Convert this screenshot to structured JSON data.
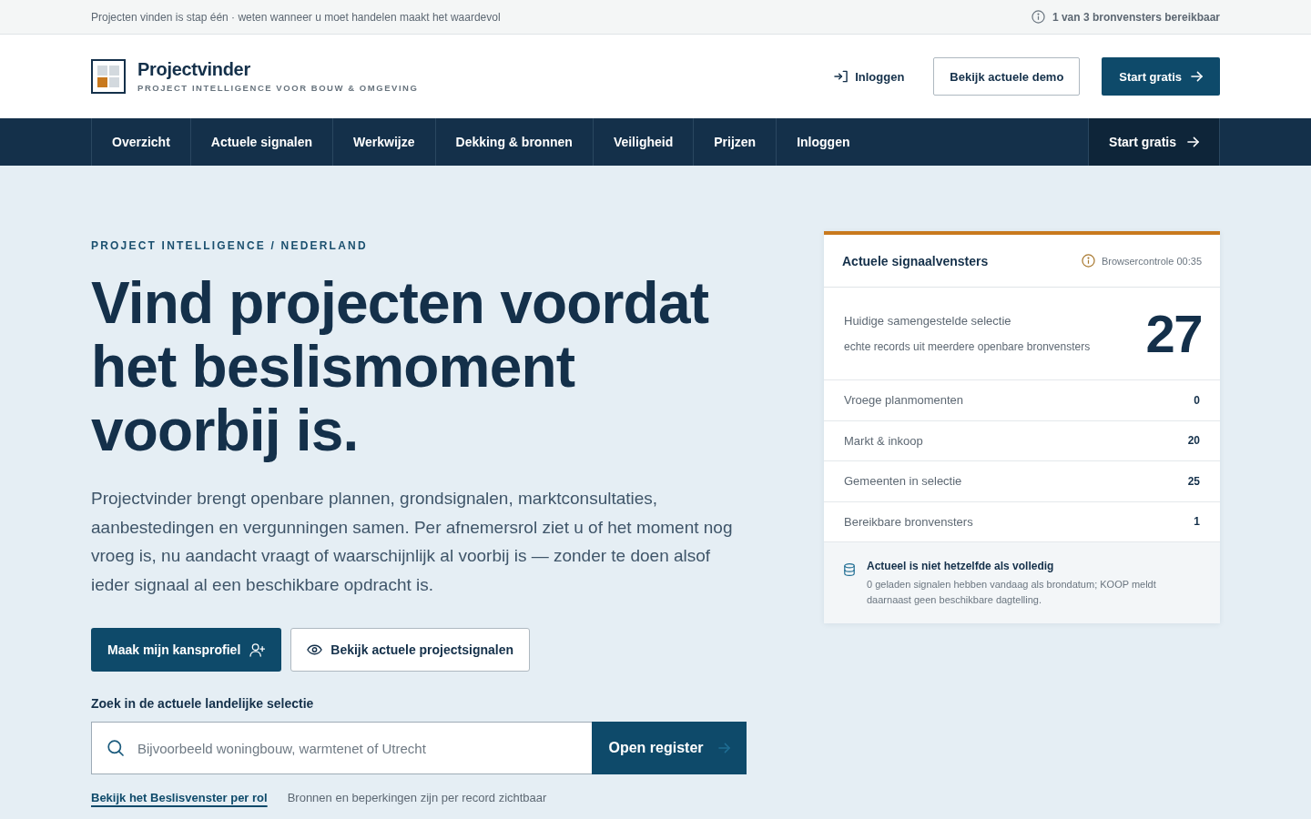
{
  "top_bar": {
    "tagline": "Projecten vinden is stap één · weten wanneer u moet handelen maakt het waardevol",
    "status": "1 van 3 bronvensters bereikbaar"
  },
  "header": {
    "brand": {
      "name": "Projectvinder",
      "subtitle": "PROJECT INTELLIGENCE VOOR BOUW & OMGEVING"
    },
    "actions": [
      {
        "label": "Inloggen",
        "kind": "link"
      },
      {
        "label": "Bekijk actuele demo",
        "kind": "outline"
      },
      {
        "label": "Start gratis",
        "kind": "primary"
      }
    ]
  },
  "nav": {
    "items": [
      {
        "label": "Overzicht"
      },
      {
        "label": "Actuele signalen"
      },
      {
        "label": "Werkwijze"
      },
      {
        "label": "Dekking & bronnen"
      },
      {
        "label": "Veiligheid"
      },
      {
        "label": "Prijzen"
      },
      {
        "label": "Inloggen"
      }
    ],
    "cta": "Start gratis"
  },
  "hero": {
    "eyebrow": "PROJECT INTELLIGENCE / NEDERLAND",
    "heading": "Vind projecten voordat het beslismoment voorbij is.",
    "intro": "Projectvinder brengt openbare plannen, grondsignalen, marktconsultaties, aanbestedingen en vergunningen samen. Per afnemersrol ziet u of het moment nog vroeg is, nu aandacht vraagt of waarschijnlijk al voorbij is — zonder te doen alsof ieder signaal al een beschikbare opdracht is.",
    "buttons": [
      {
        "label": "Maak mijn kansprofiel",
        "kind": "primary"
      },
      {
        "label": "Bekijk actuele projectsignalen",
        "kind": "secondary"
      }
    ],
    "search": {
      "label": "Zoek in de actuele landelijke selectie",
      "placeholder": "Bijvoorbeeld woningbouw, warmtenet of Utrecht",
      "button": "Open register"
    },
    "footer_link": "Bekijk het Beslisvenster per rol",
    "footer_note": "Bronnen en beperkingen zijn per record zichtbaar"
  },
  "signal_card": {
    "title": "Actuele signaalvensters",
    "check": "Browsercontrole 00:35",
    "summary": {
      "label": "Huidige samengestelde selectie",
      "sublabel": "echte records uit meerdere openbare bronvensters",
      "count": "27"
    },
    "rows": [
      {
        "label": "Vroege planmomenten",
        "value": "0"
      },
      {
        "label": "Markt & inkoop",
        "value": "20"
      },
      {
        "label": "Gemeenten in selectie",
        "value": "25"
      },
      {
        "label": "Bereikbare bronvensters",
        "value": "1"
      }
    ],
    "notice": {
      "title": "Actueel is niet hetzelfde als volledig",
      "text": "0 geladen signalen hebben vandaag als brondatum; KOOP meldt daarnaast geen beschikbare dagtelling."
    }
  }
}
